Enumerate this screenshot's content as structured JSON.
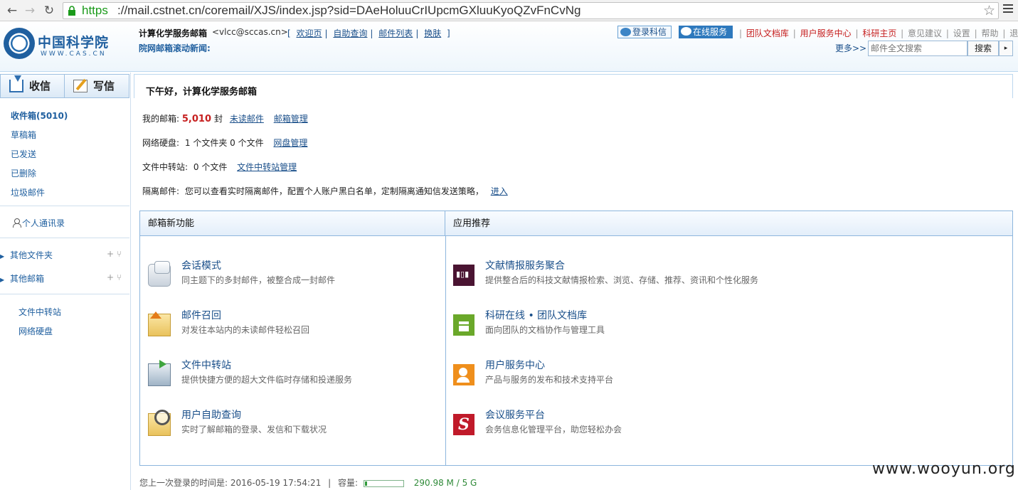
{
  "browser": {
    "url_scheme": "https",
    "url_rest": "://mail.cstnet.cn/coremail/XJS/index.jsp?sid=DAeHoluuCrIUpcmGXluuKyoQZvFnCvNg"
  },
  "header": {
    "logo_cn": "中国科学院",
    "logo_en": "WWW.CAS.CN",
    "account_name": "计算化学服务邮箱",
    "account_email": "<vlcc@sccas.cn>",
    "bracket_open": "[",
    "bracket_close": "]",
    "links": [
      "欢迎页",
      "自助查询",
      "邮件列表",
      "换肤"
    ],
    "news_label": "院网邮箱滚动新闻:",
    "btn_login_kexin": "登录科信",
    "btn_online_service": "在线服务",
    "top_links_red": [
      "团队文档库",
      "用户服务中心",
      "科研主页"
    ],
    "top_links_gray": [
      "意见建议",
      "设置",
      "帮助",
      "退出"
    ],
    "separator": "|",
    "more_label": "更多>>",
    "search_placeholder": "邮件全文搜索",
    "search_button": "搜索",
    "search_dropdown": "▸"
  },
  "sidebar": {
    "receive_label": "收信",
    "write_label": "写信",
    "folders": [
      "收件箱(5010)",
      "草稿箱",
      "已发送",
      "已删除",
      "垃圾邮件"
    ],
    "contacts_label": "个人通讯录",
    "tree": [
      {
        "label": "其他文件夹",
        "tools": "+ ⑂"
      },
      {
        "label": "其他邮箱",
        "tools": "+ ⑂"
      }
    ],
    "tree_caret": "▶",
    "extra_links": [
      "文件中转站",
      "网络硬盘"
    ]
  },
  "main": {
    "greeting": "下午好，计算化学服务邮箱",
    "mailbox": {
      "label": "我的邮箱:",
      "count": "5,010",
      "unit": "封",
      "unread_link": "未读邮件",
      "manage_link": "邮箱管理"
    },
    "netdisk": {
      "label": "网络硬盘:",
      "text": "1 个文件夹 0 个文件",
      "manage_link": "网盘管理"
    },
    "transfer": {
      "label": "文件中转站:",
      "text": "0 个文件",
      "manage_link": "文件中转站管理"
    },
    "quarantine": {
      "label": "隔离邮件:",
      "text": "您可以查看实时隔离邮件，配置个人账户黑白名单，定制隔离通知信发送策略，",
      "link": "进入"
    },
    "left_panel_title": "邮箱新功能",
    "right_panel_title": "应用推荐",
    "features": [
      {
        "title": "会话模式",
        "desc": "同主题下的多封邮件，被整合成一封邮件"
      },
      {
        "title": "邮件召回",
        "desc": "对发往本站内的未读邮件轻松召回"
      },
      {
        "title": "文件中转站",
        "desc": "提供快捷方便的超大文件临时存储和投递服务"
      },
      {
        "title": "用户自助查询",
        "desc": "实时了解邮箱的登录、发信和下载状况"
      }
    ],
    "apps": [
      {
        "title": "文献情报服务聚合",
        "desc": "提供整合后的科技文献情报检索、浏览、存储、推荐、资讯和个性化服务"
      },
      {
        "title": "科研在线 • 团队文档库",
        "desc": "面向团队的文档协作与管理工具"
      },
      {
        "title": "用户服务中心",
        "desc": "产品与服务的发布和技术支持平台"
      },
      {
        "title": "会议服务平台",
        "desc": "会务信息化管理平台，助您轻松办会"
      }
    ],
    "status": {
      "last_login_label": "您上一次登录的时间是:",
      "last_login_time": "2016-05-19 17:54:21",
      "sep": "|",
      "capacity_label": "容量:",
      "capacity_value": "290.98 M / 5 G",
      "capacity_fraction": 0.057
    }
  },
  "watermark": "www.wooyun.org"
}
